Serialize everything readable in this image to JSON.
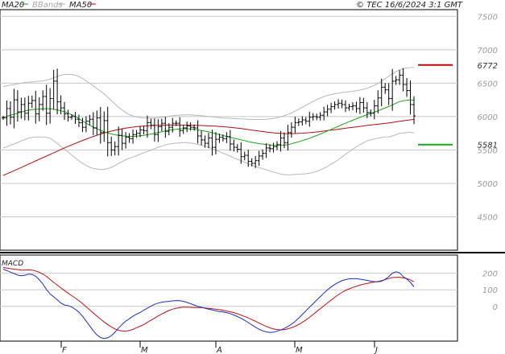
{
  "copyright": "© TEC 16/6/2024 3:1 GMT",
  "legend": [
    {
      "label": "MA20",
      "color": "#1aa51a"
    },
    {
      "label": "BBands",
      "color": "#b0b0b0"
    },
    {
      "label": "MA50",
      "color": "#b01010"
    }
  ],
  "macd_label": "MACD",
  "chart_data": [
    {
      "type": "line",
      "panel": "price",
      "x_ticks": [
        "F",
        "M",
        "A",
        "M",
        "J"
      ],
      "y_ticks": [
        4500,
        5000,
        5500,
        6000,
        6500,
        7000,
        7500
      ],
      "ylim": [
        4000,
        7600
      ],
      "grid": true,
      "price_series": {
        "name": "Price",
        "values": [
          5980,
          6120,
          5990,
          6250,
          6070,
          6180,
          6050,
          6200,
          6240,
          6040,
          6180,
          6300,
          6050,
          6270,
          6530,
          6220,
          6130,
          6040,
          5990,
          6000,
          5960,
          5910,
          5840,
          5930,
          5960,
          5830,
          5980,
          5760,
          5940,
          5610,
          5500,
          5550,
          5720,
          5600,
          5690,
          5670,
          5730,
          5750,
          5800,
          5790,
          5910,
          5870,
          5730,
          5850,
          5900,
          5780,
          5840,
          5900,
          5900,
          5790,
          5830,
          5860,
          5840,
          5830,
          5710,
          5650,
          5600,
          5680,
          5540,
          5660,
          5690,
          5670,
          5700,
          5590,
          5540,
          5510,
          5400,
          5420,
          5330,
          5300,
          5340,
          5410,
          5450,
          5530,
          5520,
          5550,
          5580,
          5680,
          5610,
          5760,
          5840,
          5910,
          5920,
          5950,
          5930,
          5990,
          6000,
          5990,
          6020,
          6070,
          6110,
          6150,
          6180,
          6200,
          6180,
          6130,
          6150,
          6160,
          6120,
          6210,
          6130,
          6060,
          6050,
          6160,
          6280,
          6440,
          6400,
          6270,
          6530,
          6550,
          6620,
          6480,
          6390,
          6180,
          6010
        ]
      },
      "ma20": {
        "name": "MA20",
        "values": [
          5990,
          6003,
          6021,
          6034,
          6050,
          6068,
          6082,
          6096,
          6104,
          6110,
          6112,
          6115,
          6118,
          6118,
          6109,
          6100,
          6086,
          6072,
          6052,
          6028,
          6002,
          5970,
          5935,
          5902,
          5870,
          5842,
          5818,
          5794,
          5774,
          5756,
          5740,
          5728,
          5719,
          5712,
          5707,
          5703,
          5702,
          5705,
          5712,
          5719,
          5728,
          5738,
          5750,
          5762,
          5774,
          5786,
          5797,
          5804,
          5810,
          5814,
          5818,
          5818,
          5815,
          5809,
          5800,
          5792,
          5782,
          5771,
          5758,
          5745,
          5730,
          5716,
          5704,
          5690,
          5676,
          5664,
          5652,
          5640,
          5626,
          5615,
          5604,
          5595,
          5588,
          5582,
          5576,
          5571,
          5568,
          5568,
          5572,
          5580,
          5593,
          5608,
          5623,
          5640,
          5657,
          5676,
          5696,
          5717,
          5740,
          5762,
          5784,
          5808,
          5831,
          5854,
          5878,
          5901,
          5923,
          5945,
          5967,
          5988,
          6009,
          6030,
          6048,
          6066,
          6086,
          6108,
          6130,
          6150,
          6175,
          6200,
          6224,
          6236,
          6244,
          6250,
          6245
        ]
      },
      "ma50": {
        "name": "MA50",
        "values": [
          5120,
          5143,
          5166,
          5190,
          5214,
          5238,
          5262,
          5287,
          5311,
          5336,
          5360,
          5385,
          5409,
          5434,
          5458,
          5482,
          5507,
          5531,
          5554,
          5576,
          5599,
          5620,
          5642,
          5662,
          5682,
          5702,
          5720,
          5737,
          5754,
          5769,
          5782,
          5795,
          5806,
          5817,
          5826,
          5835,
          5842,
          5849,
          5854,
          5859,
          5862,
          5866,
          5868,
          5870,
          5871,
          5872,
          5873,
          5873,
          5873,
          5872,
          5872,
          5871,
          5870,
          5869,
          5867,
          5866,
          5864,
          5862,
          5859,
          5856,
          5852,
          5848,
          5843,
          5838,
          5833,
          5827,
          5820,
          5813,
          5806,
          5798,
          5791,
          5783,
          5776,
          5769,
          5763,
          5757,
          5752,
          5749,
          5746,
          5745,
          5745,
          5746,
          5748,
          5751,
          5755,
          5759,
          5764,
          5770,
          5776,
          5783,
          5790,
          5797,
          5804,
          5811,
          5818,
          5825,
          5832,
          5839,
          5846,
          5853,
          5860,
          5867,
          5873,
          5879,
          5885,
          5892,
          5898,
          5905,
          5913,
          5921,
          5930,
          5937,
          5944,
          5951,
          5958
        ]
      },
      "bb_upper": {
        "name": "BBands upper",
        "values": [
          6450,
          6460,
          6470,
          6480,
          6490,
          6500,
          6510,
          6515,
          6520,
          6525,
          6530,
          6535,
          6545,
          6560,
          6580,
          6600,
          6620,
          6630,
          6632,
          6630,
          6620,
          6600,
          6570,
          6535,
          6500,
          6460,
          6420,
          6380,
          6340,
          6290,
          6240,
          6190,
          6140,
          6100,
          6060,
          6030,
          6010,
          5995,
          5985,
          5980,
          5978,
          5978,
          5980,
          5984,
          5990,
          5997,
          6005,
          6012,
          6018,
          6022,
          6025,
          6026,
          6025,
          6022,
          6018,
          6013,
          6008,
          6002,
          5996,
          5990,
          5985,
          5980,
          5976,
          5973,
          5970,
          5967,
          5964,
          5962,
          5960,
          5958,
          5956,
          5955,
          5956,
          5960,
          5965,
          5972,
          5982,
          5996,
          6012,
          6032,
          6055,
          6082,
          6110,
          6140,
          6170,
          6200,
          6228,
          6254,
          6278,
          6298,
          6316,
          6330,
          6342,
          6352,
          6360,
          6366,
          6372,
          6378,
          6386,
          6396,
          6408,
          6424,
          6444,
          6468,
          6496,
          6530,
          6566,
          6604,
          6640,
          6672,
          6698,
          6716,
          6728,
          6733,
          6734
        ]
      },
      "bb_lower": {
        "name": "BBands lower",
        "values": [
          5530,
          5546,
          5572,
          5588,
          5610,
          5636,
          5654,
          5677,
          5688,
          5695,
          5694,
          5695,
          5691,
          5676,
          5638,
          5600,
          5552,
          5514,
          5472,
          5426,
          5384,
          5340,
          5300,
          5269,
          5240,
          5224,
          5216,
          5208,
          5208,
          5222,
          5240,
          5266,
          5298,
          5324,
          5354,
          5376,
          5394,
          5415,
          5439,
          5458,
          5478,
          5498,
          5520,
          5540,
          5558,
          5575,
          5589,
          5596,
          5602,
          5606,
          5611,
          5610,
          5605,
          5596,
          5582,
          5571,
          5556,
          5540,
          5520,
          5500,
          5475,
          5452,
          5432,
          5407,
          5382,
          5361,
          5340,
          5318,
          5292,
          5272,
          5252,
          5235,
          5220,
          5204,
          5187,
          5170,
          5154,
          5140,
          5132,
          5128,
          5131,
          5134,
          5136,
          5140,
          5144,
          5152,
          5164,
          5180,
          5202,
          5226,
          5252,
          5286,
          5320,
          5356,
          5396,
          5436,
          5474,
          5512,
          5548,
          5580,
          5610,
          5636,
          5652,
          5664,
          5676,
          5686,
          5694,
          5696,
          5710,
          5728,
          5750,
          5756,
          5760,
          5767,
          5756
        ]
      },
      "annotations": [
        {
          "value": 6772,
          "label": "6772",
          "color": "#cc0000"
        },
        {
          "value": 5581,
          "label": "5581",
          "color": "#1aa51a"
        }
      ]
    },
    {
      "type": "line",
      "panel": "macd",
      "title": "MACD",
      "y_ticks": [
        0,
        100,
        200
      ],
      "ylim": [
        -210,
        310
      ],
      "series": [
        {
          "values": [
            225,
            216,
            207,
            198,
            189,
            185,
            188,
            195,
            193,
            182,
            162,
            135,
            102,
            75,
            58,
            40,
            20,
            8,
            5,
            -4,
            -18,
            -34,
            -60,
            -88,
            -118,
            -148,
            -172,
            -188,
            -195,
            -190,
            -178,
            -156,
            -131,
            -109,
            -89,
            -75,
            -60,
            -47,
            -37,
            -23,
            -11,
            1,
            12,
            20,
            25,
            28,
            30,
            33,
            35,
            34,
            30,
            24,
            16,
            8,
            0,
            -5,
            -11,
            -17,
            -22,
            -27,
            -31,
            -34,
            -38,
            -44,
            -52,
            -62,
            -72,
            -84,
            -98,
            -112,
            -126,
            -138,
            -148,
            -154,
            -158,
            -156,
            -150,
            -143,
            -133,
            -122,
            -108,
            -91,
            -71,
            -49,
            -27,
            -5,
            16,
            38,
            59,
            80,
            100,
            117,
            132,
            145,
            155,
            162,
            166,
            167,
            167,
            164,
            161,
            157,
            152,
            149,
            148,
            152,
            163,
            180,
            200,
            209,
            202,
            180,
            165,
            145,
            118
          ]
        },
        {
          "values": [
            235,
            232,
            228,
            225,
            222,
            219,
            219,
            220,
            219,
            214,
            206,
            195,
            181,
            163,
            145,
            128,
            111,
            95,
            80,
            65,
            50,
            35,
            17,
            -2,
            -21,
            -40,
            -59,
            -77,
            -95,
            -110,
            -124,
            -136,
            -145,
            -149,
            -150,
            -146,
            -139,
            -129,
            -120,
            -110,
            -97,
            -84,
            -71,
            -58,
            -46,
            -35,
            -25,
            -17,
            -11,
            -7,
            -5,
            -5,
            -6,
            -7,
            -7,
            -8,
            -10,
            -12,
            -14,
            -17,
            -20,
            -24,
            -28,
            -33,
            -38,
            -45,
            -53,
            -61,
            -70,
            -80,
            -90,
            -101,
            -112,
            -121,
            -130,
            -136,
            -140,
            -142,
            -141,
            -136,
            -129,
            -120,
            -110,
            -97,
            -82,
            -66,
            -49,
            -31,
            -14,
            4,
            21,
            38,
            55,
            70,
            84,
            96,
            106,
            114,
            121,
            128,
            134,
            139,
            143,
            147,
            150,
            155,
            162,
            168,
            174,
            176,
            176,
            172,
            168,
            160,
            148
          ]
        }
      ]
    }
  ]
}
